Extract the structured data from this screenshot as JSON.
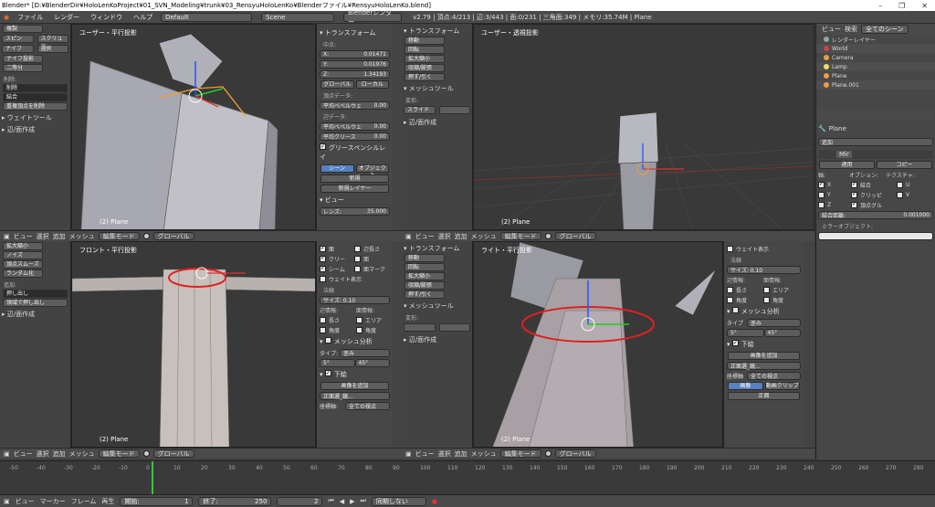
{
  "title": "Blender* [D:¥BlenderDir¥HoloLenKoProject¥01_SVN_Modeling¥trunk¥03_RensyuHoloLenKo¥Blenderファイル¥RensyuHoloLenKo.blend]",
  "menu": [
    "ファイル",
    "レンダー",
    "ウィンドウ",
    "ヘルプ"
  ],
  "layout": "Default",
  "scene": "Scene",
  "engine": "Blenderレンダー",
  "stats": "v2.79 | 頂点:4/213 | 辺:3/443 | 面:0/231 | 三角面:349 | メモリ:35.74M | Plane",
  "viewports": {
    "tl_label": "ユーザー・平行投影",
    "tr_label": "ユーザー・透視投影",
    "bl_label": "フロント・平行投影",
    "br_label": "ライト・平行投影",
    "object": "(2) Plane"
  },
  "tool_tl": {
    "items": [
      "複製",
      "スピン",
      "スクリュー",
      "ナイフ",
      "選択",
      "ナイフ投影",
      "二等分"
    ],
    "del_label": "削除:",
    "del_btn": "削除",
    "join_btn": "結合",
    "remove_double": "重複頂点を削除",
    "weight_tool": "ウェイトツール",
    "edge_face": "辺/面作成"
  },
  "npanel": {
    "transform": "トランスフォーム",
    "median": "中点:",
    "x": "0.01471",
    "y": "0.01976",
    "z": "1.34193",
    "global": "グローバル",
    "local": "ローカル",
    "vertex_data": "頂点データ:",
    "bevel_w": "平均ベベルウェ",
    "bevel_val": "0.00",
    "edge_data": "辺データ:",
    "edge_bevel": "平均ベベルウェ",
    "edge_crease": "平均クリース",
    "gp_layer": "グリースペンシルレイ",
    "scene_btn": "シーン",
    "object_btn": "オブジェクト",
    "new": "新規",
    "new_layer": "新規レイヤー",
    "view": "ビュー",
    "lens_label": "レンズ:",
    "lens_val": "35.000"
  },
  "tool_tr": {
    "transform": "トランスフォーム",
    "items": [
      "移動",
      "回転",
      "拡大縮小",
      "収縮/膨張",
      "押す/引く"
    ],
    "mesh_tool": "メッシュツール",
    "deform": "変形:",
    "slide": "スライド",
    "edge_face": "辺/面作成"
  },
  "tool_bl": {
    "items": [
      "拡大縮小",
      "ノイズ",
      "頂点スムーズ",
      "ランダム化"
    ],
    "add": "追加:",
    "extrude": "押し出し",
    "extrude_region": "領域で押し出し",
    "edge_face": "辺/面作成"
  },
  "npanel_bl": {
    "checks": [
      "面",
      "辺",
      "クリー",
      "シーム",
      "ウェイト表示"
    ],
    "right_checks": [
      "辺長さ",
      "面",
      "面マーク"
    ],
    "normal": "法線",
    "size": "サイズ: 0.10",
    "edge_info": "辺情報:",
    "face_info": "面情報:",
    "length": "長さ",
    "area": "エリア",
    "angle": "角度",
    "mesh_analysis": "メッシュ分析",
    "type": "タイプ:",
    "type_val": "歪み",
    "deg1": "5°",
    "deg2": "45°",
    "background": "下絵",
    "add_image": "画像を追加",
    "image_name": "正面選_鏡...",
    "axis": "座標軸:",
    "all_views": "全ての視点"
  },
  "tool_br": {
    "transform": "トランスフォーム",
    "items": [
      "移動",
      "回転",
      "拡大縮小",
      "収縮/膨張",
      "押す/引く"
    ],
    "mesh_tool": "メッシュツール",
    "deform": "変形:",
    "edge_face": "辺/面作成"
  },
  "npanel_br": {
    "weight": "ウェイト表示",
    "normal": "法線",
    "size": "サイズ: 0.10",
    "edge_info": "辺情報:",
    "face_info": "面情報:",
    "length": "長さ",
    "area": "エリア",
    "angle": "角度",
    "mesh_analysis": "メッシュ分析",
    "type": "タイプ",
    "type_val": "歪み",
    "deg1": "5°",
    "deg2": "45°",
    "background": "下絵",
    "add_image": "画像を追加",
    "image_name": "正面選_鏡...",
    "axis": "座標軸",
    "all_views": "全ての視点",
    "image": "画像",
    "movie": "動画クリップ",
    "front": "正面"
  },
  "outliner": {
    "view": "ビュー",
    "search": "検索",
    "all_scenes": "全てのシーン",
    "rows": [
      "レンダーレイヤー",
      "World",
      "Camera",
      "Lamp",
      "Plane",
      "Plane.001"
    ]
  },
  "props": {
    "plane": "Plane",
    "add": "追加",
    "mirror": "Mir",
    "apply": "適用",
    "copy": "コピー",
    "axis": "軸:",
    "option": "オプション:",
    "texture": "テクスチャ:",
    "x": "X",
    "y": "Y",
    "z": "Z",
    "merge": "結合",
    "clipping": "クリッピ",
    "vgroup": "頂点グル",
    "u": "U",
    "v": "V",
    "merge_dist": "結合距離:",
    "merge_dist_val": "0.001000",
    "mirror_obj": "ミラーオブジェクト:"
  },
  "view_header": {
    "view": "ビュー",
    "select": "選択",
    "add": "追加",
    "mesh": "メッシュ",
    "mode": "編集モード",
    "global": "グローバル"
  },
  "timeline": {
    "ticks": [
      "-50",
      "-40",
      "-30",
      "-20",
      "-10",
      "0",
      "10",
      "20",
      "30",
      "40",
      "50",
      "60",
      "70",
      "80",
      "90",
      "100",
      "110",
      "120",
      "130",
      "140",
      "150",
      "160",
      "170",
      "180",
      "190",
      "200",
      "210",
      "220",
      "230",
      "240",
      "250",
      "260",
      "270",
      "280"
    ],
    "view": "ビュー",
    "marker": "マーカー",
    "frame": "フレーム",
    "play": "再生",
    "start_label": "開始:",
    "start": "1",
    "end_label": "終了:",
    "end": "250",
    "current": "2",
    "sync": "同期しない"
  }
}
